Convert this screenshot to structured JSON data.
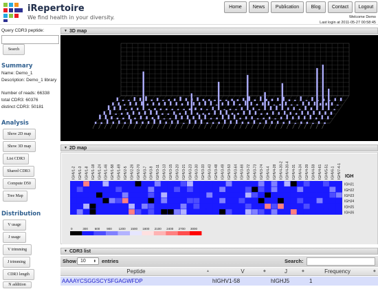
{
  "header": {
    "brand_name": "iRepertoire",
    "tagline": "We find health in your diversity.",
    "nav": [
      "Home",
      "News",
      "Publication",
      "Blog",
      "Contact",
      "Logout"
    ],
    "welcome": "Welcome Demo",
    "last_login": "Last login at 2011-05-27 00:58:45"
  },
  "sidebar": {
    "query_label": "Query CDR3 peptide:",
    "search_button": "Search",
    "summary_title": "Summary",
    "summary": {
      "name": "Name: Demo_1",
      "description": "Description: Demo_1 library",
      "reads": "Number of reads: 66338",
      "total_cdr3": "total CDR3: 60376",
      "distinct_cdr3": "distinct CDR3: 50181"
    },
    "analysis_title": "Analysis",
    "analysis_buttons": [
      "Show 2D map",
      "Show 3D map",
      "List CDR3",
      "Shared CDR3",
      "Compute D50",
      "Tree Map"
    ],
    "distribution_title": "Distribution",
    "distribution_buttons": [
      "V usage",
      "J usage",
      "V trimming",
      "J trimming",
      "CDR3 length",
      "N addition"
    ]
  },
  "panels": {
    "map3d_title": "3D map",
    "map2d_title": "2D map",
    "cdr3_title": "CDR3 list"
  },
  "map2d": {
    "v_genes": [
      "IGHV1-2",
      "IGHV1-3",
      "IGHV1-8",
      "IGHV1-18",
      "IGHV1-24",
      "IGHV1-46",
      "IGHV1-58",
      "IGHV1-69",
      "IGHV2-5",
      "IGHV2-26",
      "IGHV2-70",
      "IGHV3-7",
      "IGHV3-9",
      "IGHV3-11",
      "IGHV3-13",
      "IGHV3-15",
      "IGHV3-20",
      "IGHV3-21",
      "IGHV3-23",
      "IGHV3-30",
      "IGHV3-33",
      "IGHV3-43",
      "IGHV3-48",
      "IGHV3-49",
      "IGHV3-53",
      "IGHV3-64",
      "IGHV3-66",
      "IGHV3-72",
      "IGHV3-73",
      "IGHV3-74",
      "IGHV4-4",
      "IGHV4-28",
      "IGHV4-30-2",
      "IGHV4-30-4",
      "IGHV4-31",
      "IGHV4-34",
      "IGHV4-39",
      "IGHV4-59",
      "IGHV4-61",
      "IGHV5-51",
      "IGHV6-1",
      "IGHV7-4-1"
    ],
    "j_label": "IGH",
    "j_genes": [
      "IGHJ1",
      "IGHJ2",
      "IGHJ3",
      "IGHJ4",
      "IGHJ5",
      "IGHJ6"
    ],
    "legend_ticks": [
      "0",
      "300",
      "600",
      "900",
      "1200",
      "1500",
      "1800",
      "2100",
      "2400",
      "2700",
      "3000"
    ],
    "legend_colors": [
      "#000000",
      "#1a1aff",
      "#4d4dff",
      "#8080ff",
      "#b3b3ff",
      "#e6e6ff",
      "#ffe0e0",
      "#ffb3b3",
      "#ff8080",
      "#ff4d4d",
      "#ff0000"
    ],
    "low_color": "#1a1aff",
    "empty_color": "#000000"
  },
  "cdr3_list": {
    "show_label": "Show",
    "page_size": "10",
    "entries_label": "entries",
    "search_label": "Search:",
    "columns": [
      "Peptide",
      "V",
      "J",
      "Frequency"
    ],
    "rows": [
      {
        "peptide": "AAAAYCSGGSCYSFGAGWFDP",
        "v": "hIGHV1-58",
        "j": "hIGHJ5",
        "frequency": "1"
      }
    ]
  },
  "colors": {
    "brand_text": "#1f2d4a",
    "section_heading": "#2f5f8f",
    "peptide_link": "#1a1acc",
    "row_highlight": "#d8defb",
    "bar_color": "#b6b6ff"
  }
}
